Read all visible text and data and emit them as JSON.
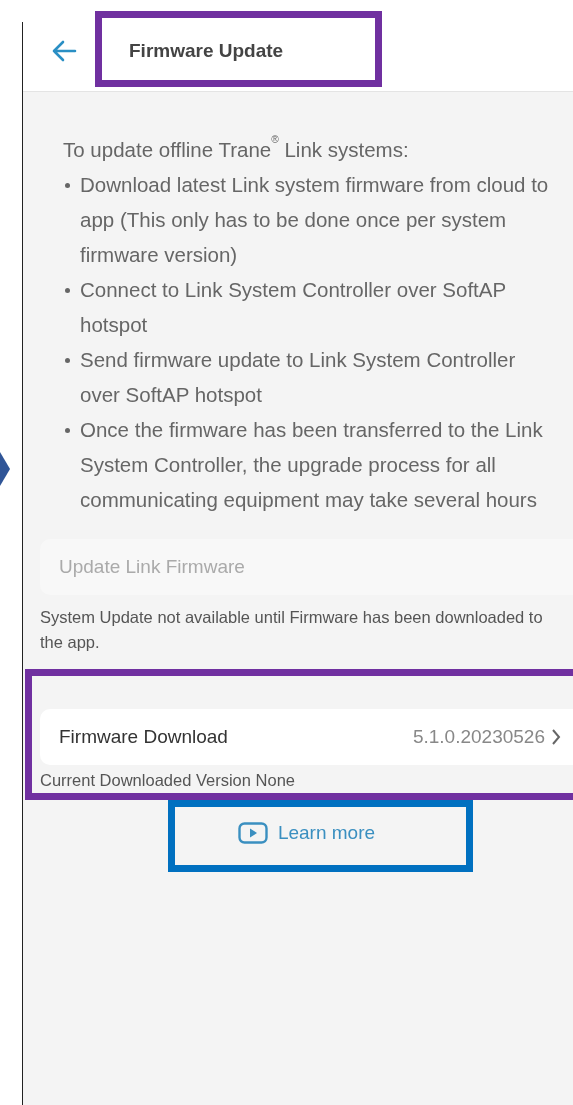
{
  "header": {
    "title": "Firmware Update"
  },
  "instructions": {
    "intro": "To update offline Trane$^{®}$ Link systems:",
    "steps": [
      "Download latest Link system firmware from cloud to app (This only has to be done once per system firmware version)",
      "Connect to Link System Controller over SoftAP hotspot",
      "Send firmware update to Link System Controller over SoftAP hotspot",
      "Once the firmware has been transferred to the Link System Controller, the upgrade process for all communicating equipment may take several hours"
    ]
  },
  "update_button": {
    "label": "Update Link Firmware",
    "disabled": true
  },
  "update_note": "System Update not available until Firmware has been downloaded to the app.",
  "firmware_download": {
    "label": "Firmware Download",
    "version": "5.1.0.20230526",
    "note": "Current Downloaded Version None"
  },
  "learn_more": {
    "label": "Learn more"
  },
  "highlights": [
    {
      "color": "#7030a0"
    },
    {
      "color": "#7030a0"
    },
    {
      "color": "#0070c0"
    }
  ]
}
